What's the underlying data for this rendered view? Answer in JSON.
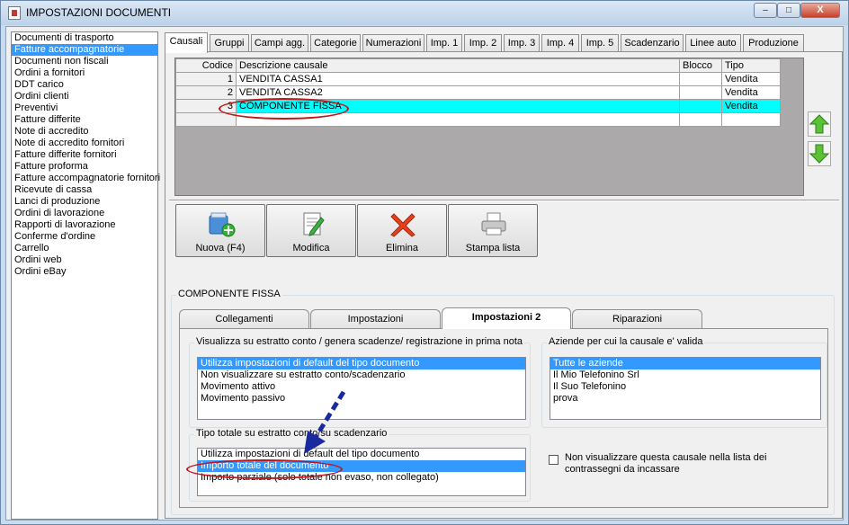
{
  "window": {
    "title": "IMPOSTAZIONI DOCUMENTI",
    "min_label": "–",
    "max_label": "□",
    "close_label": "X"
  },
  "left_list": {
    "items": [
      "Documenti di trasporto",
      "Fatture accompagnatorie",
      "Documenti non fiscali",
      "Ordini a fornitori",
      "DDT carico",
      "Ordini clienti",
      "Preventivi",
      "Fatture differite",
      "Note di accredito",
      "Note di accredito fornitori",
      "Fatture differite fornitori",
      "Fatture proforma",
      "Fatture accompagnatorie fornitori",
      "Ricevute di cassa",
      "Lanci di produzione",
      "Ordini di lavorazione",
      "Rapporti di lavorazione",
      "Conferme d'ordine",
      "Carrello",
      "Ordini web",
      "Ordini eBay"
    ],
    "selected_index": 1
  },
  "tabs": [
    "Causali",
    "Gruppi",
    "Campi agg.",
    "Categorie",
    "Numerazioni",
    "Imp. 1",
    "Imp. 2",
    "Imp. 3",
    "Imp. 4",
    "Imp. 5",
    "Scadenzario",
    "Linee auto",
    "Produzione"
  ],
  "grid": {
    "headers": {
      "code": "Codice",
      "desc": "Descrizione causale",
      "block": "Blocco",
      "type": "Tipo"
    },
    "rows": [
      {
        "code": "1",
        "desc": "VENDITA CASSA1",
        "block": "",
        "type": "Vendita"
      },
      {
        "code": "2",
        "desc": "VENDITA CASSA2",
        "block": "",
        "type": "Vendita"
      },
      {
        "code": "3",
        "desc": "COMPONENTE FISSA",
        "block": "",
        "type": "Vendita"
      }
    ],
    "highlight_color": "#00ffff"
  },
  "toolbar": {
    "new_label": "Nuova (F4)",
    "edit_label": "Modifica",
    "delete_label": "Elimina",
    "print_label": "Stampa lista"
  },
  "detail": {
    "group_title": "COMPONENTE FISSA",
    "tabs": [
      "Collegamenti",
      "Impostazioni",
      "Impostazioni 2",
      "Riparazioni"
    ],
    "active_tab": "Impostazioni 2",
    "estratto": {
      "legend": "Visualizza su estratto conto / genera scadenze/ registrazione  in prima nota",
      "items": [
        "Utilizza impostazioni di default del tipo documento",
        "Non visualizzare su estratto conto/scadenzario",
        "Movimento attivo",
        "Movimento passivo"
      ]
    },
    "aziende": {
      "legend": "Aziende per cui la causale e' valida",
      "items": [
        "Tutte le aziende",
        "Il Mio Telefonino Srl",
        "Il Suo Telefonino",
        "prova"
      ]
    },
    "tipo_totale": {
      "legend": "Tipo totale su estratto conto/su scadenzario",
      "items": [
        "Utilizza impostazioni di default del tipo documento",
        "Importo totale del documento",
        "Importo parziale (solo totale non evaso, non collegato)"
      ]
    },
    "checkbox_label": "Non visualizzare questa causale nella lista dei contrassegni da incassare"
  },
  "colors": {
    "selection": "#3399ff",
    "annotation": "#c0161a",
    "arrow": "#1a2a9e"
  }
}
